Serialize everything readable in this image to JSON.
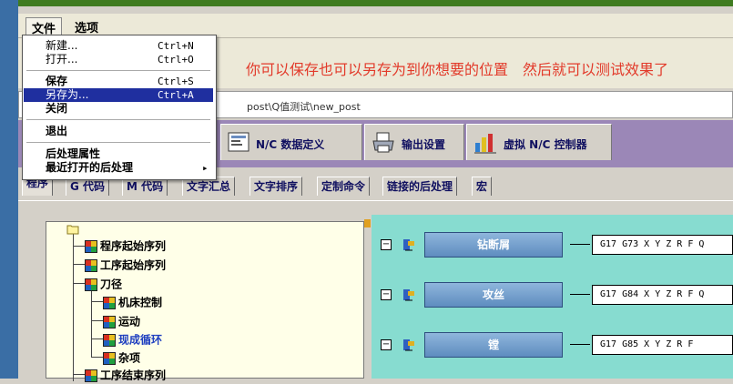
{
  "menubar": {
    "file": "文件",
    "options": "选项"
  },
  "file_menu": {
    "items": [
      {
        "label": "新建...",
        "shortcut": "Ctrl+N"
      },
      {
        "label": "打开...",
        "shortcut": "Ctrl+O"
      },
      {
        "label": "保存",
        "shortcut": "Ctrl+S"
      },
      {
        "label": "另存为...",
        "shortcut": "Ctrl+A"
      },
      {
        "label": "关闭",
        "shortcut": ""
      },
      {
        "label": "退出",
        "shortcut": ""
      },
      {
        "label": "后处理属性",
        "shortcut": ""
      },
      {
        "label": "最近打开的后处理",
        "shortcut": "▸"
      }
    ]
  },
  "annotation": "你可以保存也可以另存为到你想要的位置　然后就可以测试效果了",
  "path": "post\\Q值测试\\new_post",
  "big_tabs": [
    {
      "label": "N/C 数据定义"
    },
    {
      "label": "输出设置"
    },
    {
      "label": "虚拟 N/C 控制器"
    }
  ],
  "small_tabs": [
    "程序",
    "G 代码",
    "M 代码",
    "文字汇总",
    "文字排序",
    "定制命令",
    "链接的后处理",
    "宏"
  ],
  "tree": {
    "items": [
      "程序起始序列",
      "工序起始序列",
      "刀径",
      "机床控制",
      "运动",
      "现成循环",
      "杂项",
      "工序结束序列"
    ]
  },
  "cycles": [
    {
      "name": "钻断屑",
      "code": "G17 G73 X Y Z R F Q"
    },
    {
      "name": "攻丝",
      "code": "G17 G84 X Y Z R F Q"
    },
    {
      "name": "镗",
      "code": "G17 G85 X Y Z R F"
    }
  ],
  "colors": {
    "annotation": "#e23a2a",
    "highlight": "#1f2f9f",
    "tab_band": "#9b87b7",
    "cycle_pane": "#87dcd0",
    "tree_bg": "#ffffe8"
  }
}
